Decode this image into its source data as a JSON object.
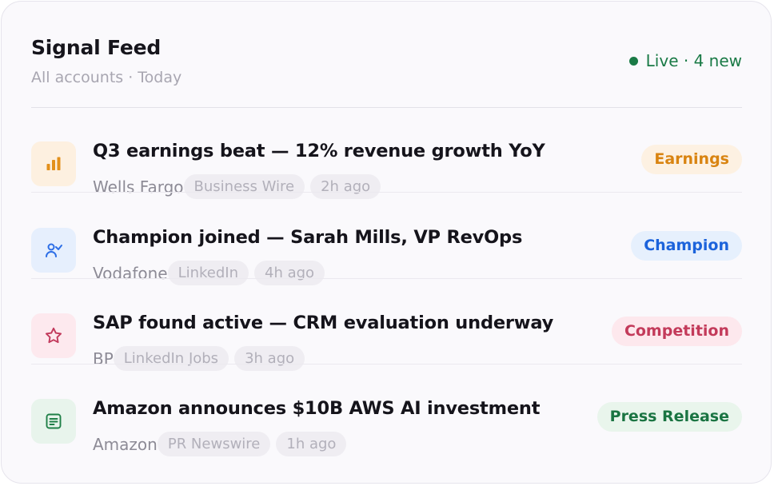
{
  "header": {
    "title": "Signal Feed",
    "subtitle": "All accounts · Today",
    "live_text": "Live · 4 new"
  },
  "signals": [
    {
      "headline": "Q3 earnings beat — 12% revenue growth YoY",
      "company": "Wells Fargo",
      "source": "Business Wire",
      "time": "2h ago",
      "tag": "Earnings",
      "icon": "bar-chart-icon",
      "colors": {
        "icon_bg": "#fdf0e0",
        "icon": "#e3901b",
        "tag_bg": "#fdf1e2",
        "tag_text": "#d98411"
      }
    },
    {
      "headline": "Champion joined — Sarah Mills, VP RevOps",
      "company": "Vodafone",
      "source": "LinkedIn",
      "time": "4h ago",
      "tag": "Champion",
      "icon": "user-add-icon",
      "colors": {
        "icon_bg": "#e6effd",
        "icon": "#2d6ee6",
        "tag_bg": "#e6f0fd",
        "tag_text": "#1c63db"
      }
    },
    {
      "headline": "SAP found active — CRM evaluation underway",
      "company": "BP",
      "source": "LinkedIn Jobs",
      "time": "3h ago",
      "tag": "Competition",
      "icon": "star-icon",
      "colors": {
        "icon_bg": "#fde9ee",
        "icon": "#c23a5c",
        "tag_bg": "#fde8ed",
        "tag_text": "#c33a5a"
      }
    },
    {
      "headline": "Amazon announces $10B AWS AI investment",
      "company": "Amazon",
      "source": "PR Newswire",
      "time": "1h ago",
      "tag": "Press Release",
      "icon": "document-icon",
      "colors": {
        "icon_bg": "#e8f4ec",
        "icon": "#1f7f47",
        "tag_bg": "#e9f5ec",
        "tag_text": "#1a7442"
      }
    }
  ]
}
